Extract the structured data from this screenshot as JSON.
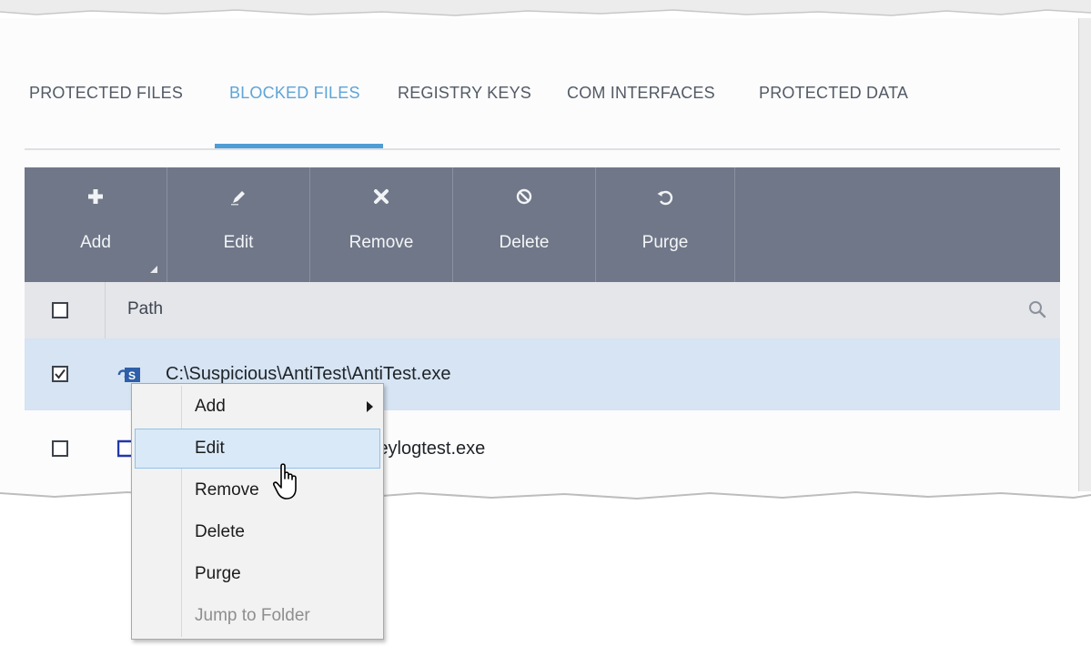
{
  "tabs": [
    {
      "label": "PROTECTED FILES",
      "active": false
    },
    {
      "label": "BLOCKED FILES",
      "active": true
    },
    {
      "label": "REGISTRY KEYS",
      "active": false
    },
    {
      "label": "COM INTERFACES",
      "active": false
    },
    {
      "label": "PROTECTED DATA",
      "active": false
    }
  ],
  "toolbar": {
    "buttons": [
      {
        "label": "Add",
        "icon": "plus-icon"
      },
      {
        "label": "Edit",
        "icon": "pencil-icon"
      },
      {
        "label": "Remove",
        "icon": "x-icon"
      },
      {
        "label": "Delete",
        "icon": "prohibited-icon"
      },
      {
        "label": "Purge",
        "icon": "refresh-icon"
      }
    ]
  },
  "table": {
    "column_header": "Path",
    "rows": [
      {
        "path": "C:\\Suspicious\\AntiTest\\AntiTest.exe",
        "checked": true,
        "selected": true
      },
      {
        "path": "C:\\Suspicious\\keylogtest\\keylogtest.exe",
        "checked": false,
        "selected": false
      }
    ]
  },
  "context_menu": {
    "items": [
      {
        "label": "Add",
        "has_submenu": true,
        "enabled": true
      },
      {
        "label": "Edit",
        "has_submenu": false,
        "enabled": true,
        "hovered": true
      },
      {
        "label": "Remove",
        "has_submenu": false,
        "enabled": true
      },
      {
        "label": "Delete",
        "has_submenu": false,
        "enabled": true
      },
      {
        "label": "Purge",
        "has_submenu": false,
        "enabled": true
      },
      {
        "label": "Jump to Folder",
        "has_submenu": false,
        "enabled": false
      }
    ]
  },
  "colors": {
    "accent": "#4f9dd5",
    "toolbar_bg": "#6f7788",
    "selected_row": "#d6e4f3",
    "menu_hover": "#d9e9f8"
  }
}
